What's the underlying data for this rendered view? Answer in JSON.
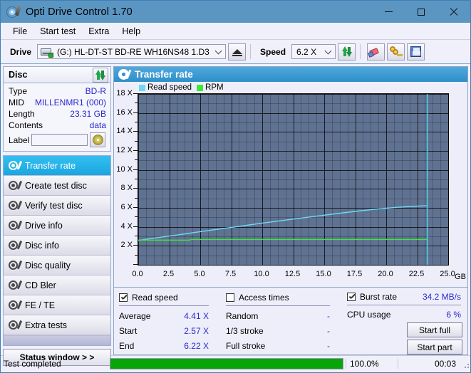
{
  "window": {
    "title": "Opti Drive Control 1.70",
    "icon": "disc-pen-icon",
    "controls": {
      "minimize": "minimize",
      "maximize": "maximize",
      "close": "close"
    }
  },
  "menubar": {
    "items": [
      "File",
      "Start test",
      "Extra",
      "Help"
    ]
  },
  "toolbar": {
    "drive_label": "Drive",
    "drive_value": "(G:)   HL-DT-ST BD-RE  WH16NS48 1.D3",
    "eject_title": "Eject",
    "speed_label": "Speed",
    "speed_value": "6.2 X",
    "refresh_title": "Refresh",
    "erase_title": "Erase",
    "key_title": "Keys",
    "save_title": "Save"
  },
  "disc_panel": {
    "title": "Disc",
    "refresh_title": "Refresh disc info",
    "rows": [
      {
        "key": "Type",
        "value": "BD-R"
      },
      {
        "key": "MID",
        "value": "MILLENMR1 (000)"
      },
      {
        "key": "Length",
        "value": "23.31 GB"
      },
      {
        "key": "Contents",
        "value": "data"
      }
    ],
    "label_key": "Label",
    "label_value": "",
    "label_placeholder": "",
    "label_button_title": "Disc label"
  },
  "sidebar": {
    "items": [
      {
        "label": "Transfer rate",
        "selected": true
      },
      {
        "label": "Create test disc",
        "selected": false
      },
      {
        "label": "Verify test disc",
        "selected": false
      },
      {
        "label": "Drive info",
        "selected": false
      },
      {
        "label": "Disc info",
        "selected": false
      },
      {
        "label": "Disc quality",
        "selected": false
      },
      {
        "label": "CD Bler",
        "selected": false
      },
      {
        "label": "FE / TE",
        "selected": false
      },
      {
        "label": "Extra tests",
        "selected": false
      }
    ],
    "status_window": "Status window > >"
  },
  "chart_panel": {
    "title": "Transfer rate",
    "icon": "disc-slash-icon"
  },
  "chart_data": {
    "type": "line",
    "title": "Transfer rate",
    "xlabel": "GB",
    "ylabel": "X",
    "xlim": [
      0,
      25
    ],
    "ylim": [
      0,
      18
    ],
    "grid": true,
    "legend_position": "top-left",
    "x_unit": "GB",
    "xticks": [
      "0.0",
      "2.5",
      "5.0",
      "7.5",
      "10.0",
      "12.5",
      "15.0",
      "17.5",
      "20.0",
      "22.5",
      "25.0"
    ],
    "xtick_values": [
      0,
      2.5,
      5,
      7.5,
      10,
      12.5,
      15,
      17.5,
      20,
      22.5,
      25
    ],
    "yticks": [
      "2 X",
      "4 X",
      "6 X",
      "8 X",
      "10 X",
      "12 X",
      "14 X",
      "16 X",
      "18 X"
    ],
    "ytick_values": [
      2,
      4,
      6,
      8,
      10,
      12,
      14,
      16,
      18
    ],
    "series": [
      {
        "name": "Read speed",
        "color": "#6fd8f5",
        "x": [
          0.0,
          1.0,
          2.0,
          3.0,
          4.0,
          5.0,
          6.0,
          7.0,
          8.0,
          9.0,
          10.0,
          11.0,
          12.0,
          13.0,
          14.0,
          15.0,
          16.0,
          17.0,
          18.0,
          19.0,
          20.0,
          21.0,
          22.0,
          23.0,
          23.31
        ],
        "y": [
          2.57,
          2.76,
          2.94,
          3.12,
          3.3,
          3.49,
          3.67,
          3.85,
          4.03,
          4.21,
          4.39,
          4.56,
          4.73,
          4.9,
          5.07,
          5.23,
          5.39,
          5.55,
          5.7,
          5.84,
          5.97,
          6.07,
          6.15,
          6.21,
          6.22
        ]
      },
      {
        "name": "RPM",
        "color": "#3ce83c",
        "x": [
          0.0,
          4.1,
          4.3,
          23.31
        ],
        "y": [
          2.6,
          2.6,
          2.67,
          2.67
        ]
      }
    ],
    "markers": [
      {
        "name": "disc-end-marker",
        "x": 23.31,
        "color": "#4fd6ef"
      }
    ]
  },
  "legend": [
    {
      "label": "Read speed",
      "color": "#6fd8f5"
    },
    {
      "label": "RPM",
      "color": "#3ce83c"
    }
  ],
  "stats": {
    "read_speed": {
      "checkbox_label": "Read speed",
      "checked": true,
      "rows": [
        {
          "key": "Average",
          "value": "4.41 X"
        },
        {
          "key": "Start",
          "value": "2.57 X"
        },
        {
          "key": "End",
          "value": "6.22 X"
        }
      ]
    },
    "access_times": {
      "checkbox_label": "Access times",
      "checked": false,
      "rows": [
        {
          "key": "Random",
          "value": "-"
        },
        {
          "key": "1/3 stroke",
          "value": "-"
        },
        {
          "key": "Full stroke",
          "value": "-"
        }
      ]
    },
    "burst_rate": {
      "checkbox_label": "Burst rate",
      "checked": true,
      "value": "34.2 MB/s",
      "cpu_key": "CPU usage",
      "cpu_value": "6 %"
    },
    "buttons": [
      {
        "label": "Start full"
      },
      {
        "label": "Start part"
      }
    ]
  },
  "statusbar": {
    "message": "Test completed",
    "progress_percent": 100.0,
    "progress_text": "100.0%",
    "elapsed": "00:03"
  },
  "colors": {
    "titlebar": "#5b96c3",
    "accent": "#2f8fc9",
    "value_blue": "#2a2ad0",
    "plot_bg": "#5f7291",
    "read_speed": "#6fd8f5",
    "rpm": "#3ce83c",
    "progress": "#08a508"
  }
}
